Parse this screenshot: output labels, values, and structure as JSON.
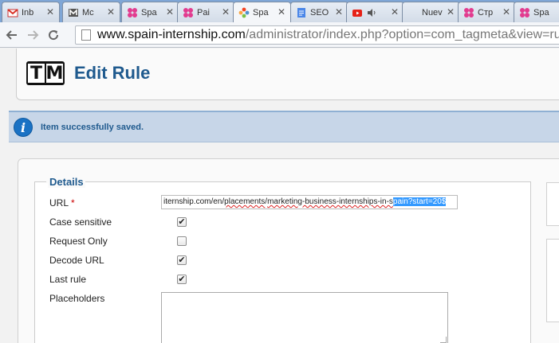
{
  "browser": {
    "tabs": [
      {
        "title": "Inb",
        "icon": "gmail-icon"
      },
      {
        "title": "Mc",
        "icon": "gmail-m-icon"
      },
      {
        "title": "Spa",
        "icon": "flower-icon"
      },
      {
        "title": "Pai",
        "icon": "flower-icon"
      },
      {
        "title": "Spa",
        "icon": "joomla-icon"
      },
      {
        "title": "SEO",
        "icon": "doc-icon"
      },
      {
        "title": "",
        "icon": "youtube-icon"
      },
      {
        "title": "Nuev",
        "icon": "blank-icon"
      },
      {
        "title": "Стр",
        "icon": "flower-icon"
      },
      {
        "title": "Spa",
        "icon": "flower-icon"
      }
    ],
    "url_host": "www.spain-internship.com",
    "url_path": "/administrator/index.php?option=com_tagmeta&view=ru"
  },
  "header": {
    "logo_left": "T",
    "logo_right": "M",
    "title": "Edit Rule"
  },
  "alert": {
    "message": "Item successfully saved."
  },
  "details": {
    "legend": "Details",
    "url_label": "URL",
    "required_mark": "*",
    "url_value_before": "iternship.com/en/",
    "url_value_spell1": "placements",
    "url_value_mid1": "/",
    "url_value_spell2": "marketing-business-internships-in-s",
    "url_value_selected": "pain?start=20$",
    "fields": [
      {
        "label": "Case sensitive",
        "checked": true
      },
      {
        "label": "Request Only",
        "checked": false
      },
      {
        "label": "Decode URL",
        "checked": true
      },
      {
        "label": "Last rule",
        "checked": true
      }
    ],
    "placeholders_label": "Placeholders",
    "check_glyph": "✔"
  },
  "colors": {
    "title_blue": "#1f5a8e",
    "info_blue": "#1a72c4",
    "alert_bg": "#c7d6e8",
    "selection": "#3399ff"
  }
}
